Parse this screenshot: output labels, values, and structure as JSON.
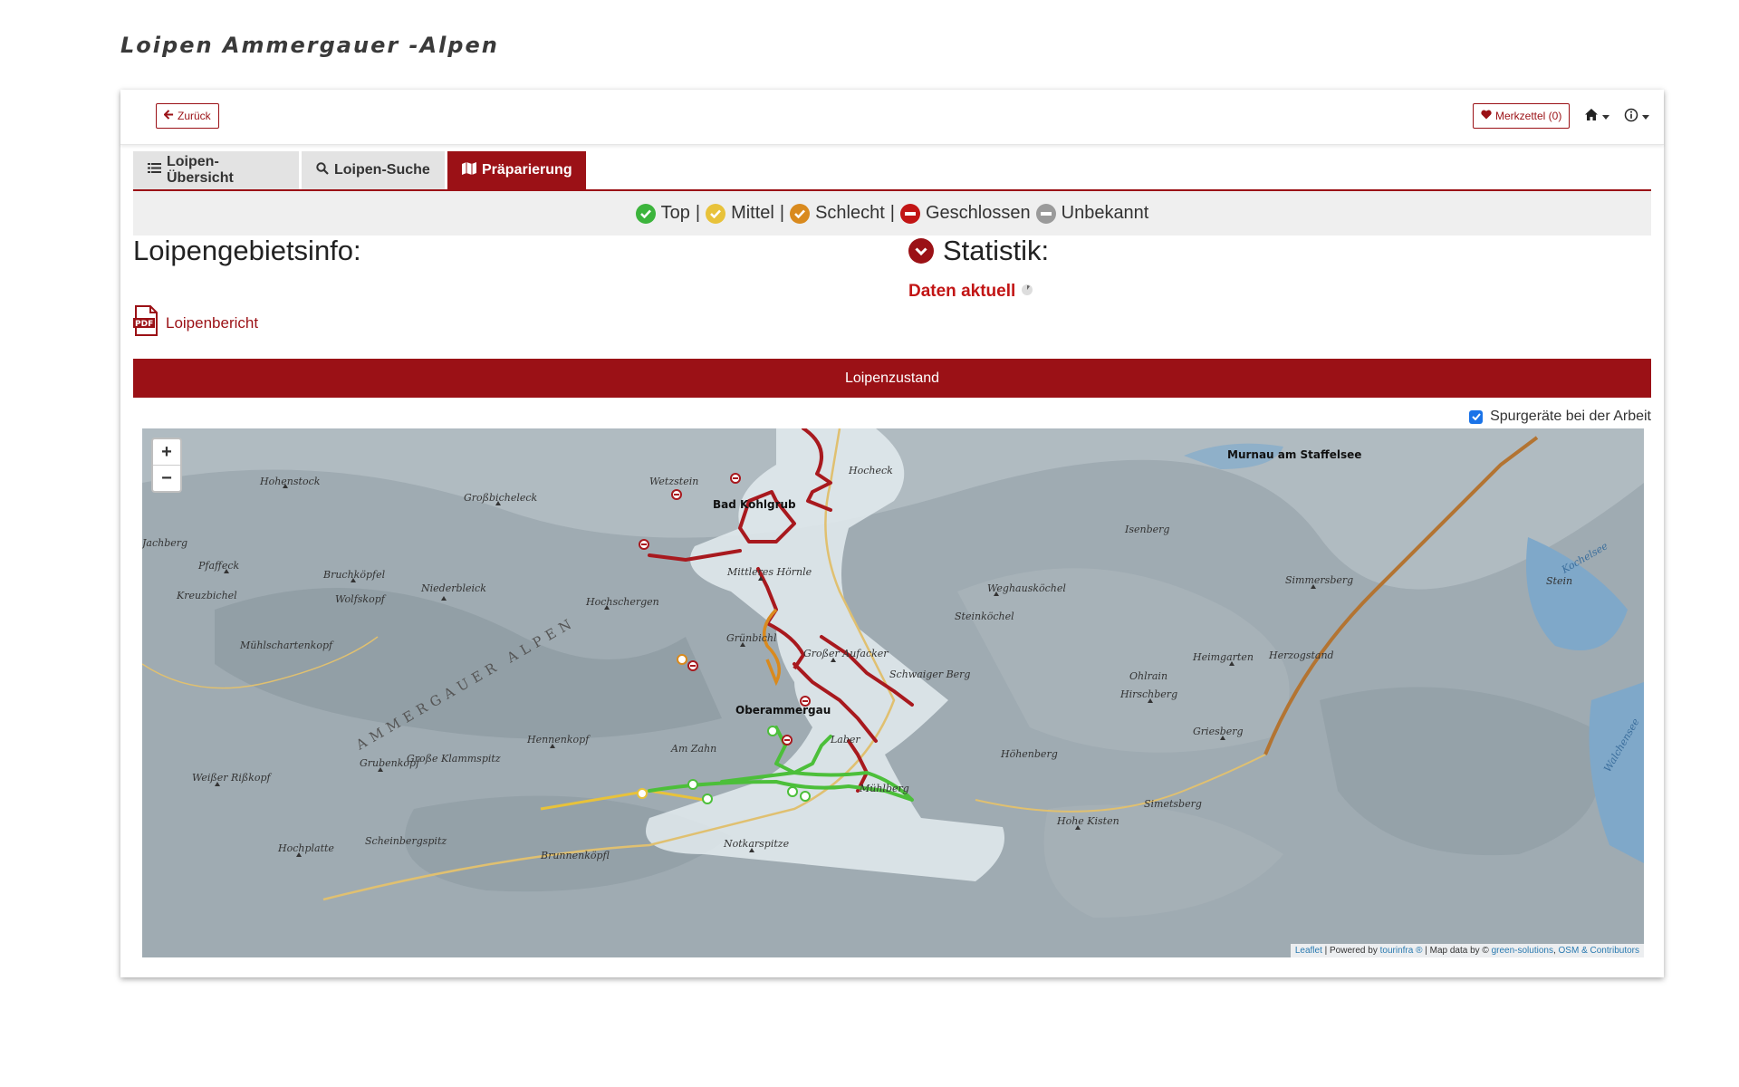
{
  "page_title": "Loipen Ammergauer -Alpen",
  "topbar": {
    "back_label": "Zurück",
    "memo_label": "Merkzettel (0)"
  },
  "tabs": [
    {
      "label": "Loipen-Übersicht",
      "icon": "list-icon"
    },
    {
      "label": "Loipen-Suche",
      "icon": "search-icon"
    },
    {
      "label": "Präparierung",
      "icon": "map-icon"
    }
  ],
  "legend": {
    "items": [
      {
        "label": "Top",
        "color": "#3cb43c"
      },
      {
        "label": "Mittel",
        "color": "#e8c23a"
      },
      {
        "label": "Schlecht",
        "color": "#d98a1e"
      },
      {
        "label": "Geschlossen",
        "color": "#c21515"
      },
      {
        "label": "Unbekannt",
        "color": "#9a9a9a"
      }
    ],
    "separator": "|"
  },
  "info": {
    "title": "Loipengebietsinfo:",
    "pdf_label": "Loipenbericht"
  },
  "stats": {
    "title": "Statistik:",
    "status": "Daten aktuell"
  },
  "section": {
    "title": "Loipenzustand"
  },
  "map": {
    "layer_toggle_label": "Spurgeräte bei der Arbeit",
    "layer_toggle_checked": true,
    "zoom_in": "+",
    "zoom_out": "−",
    "attribution": {
      "leaflet": "Leaflet",
      "sep1": " | Powered by ",
      "tourinfra": "tourinfra ®",
      "sep2": " | Map data by © ",
      "green": "green-solutions",
      "sep3": ", ",
      "osm": "OSM & Contributors"
    },
    "labels": {
      "murnau": "Murnau am Staffelsee",
      "bad_kohlgrub": "Bad Kohlgrub",
      "oberammergau": "Oberammergau",
      "hochstock": "Hohenstock",
      "hocheck": "Hocheck",
      "grossbicheleck": "Großbicheleck",
      "bruchkoepfel": "Bruchköpfel",
      "niederbleick": "Niederbleick",
      "wolfskopf": "Wolfskopf",
      "pfaffeck": "Pfaffeck",
      "kreuzbichel": "Kreuzbichel",
      "muehlschartenkopf": "Mühlschartenkopf",
      "hochschergen": "Hochschergen",
      "mittleres_hoernle": "Mittleres Hörnle",
      "gruenbichl": "Grünbichl",
      "grosser_aufacker": "Großer Aufacker",
      "schwaiger_berg": "Schwaiger Berg",
      "weghauskoechel": "Weghausköchel",
      "steinkoechel": "Steinköchel",
      "isenberg": "Isenberg",
      "simmersberg": "Simmersberg",
      "heimgarten": "Heimgarten",
      "herzogstand": "Herzogstand",
      "ohlrain": "Ohlrain",
      "hirschberg": "Hirschberg",
      "griesberg": "Griesberg",
      "hoehenberg": "Höhenberg",
      "laber": "Laber",
      "am_zahn": "Am Zahn",
      "hennenkopf": "Hennenkopf",
      "grubenkopf": "Grubenkopf",
      "grosse_klammspitz": "Große Klammspitz",
      "weisser_risskopf": "Weißer Rißkopf",
      "muehlberg": "Mühlberg",
      "hohe_kisten": "Hohe Kisten",
      "simetsberg": "Simetsberg",
      "notkarspitze": "Notkarspitze",
      "brunnenkopf": "Brunnenköpfl",
      "scheinbergspitz": "Scheinbergspitz",
      "hochplatte": "Hochplatte",
      "ammergauer_alpen": "AMMERGAUER ALPEN",
      "kochelsee": "Kochelsee",
      "walchensee": "Walchensee",
      "stein": "Stein",
      "wetzstein": "Wetzstein",
      "jachberg": "Jachberg"
    }
  }
}
